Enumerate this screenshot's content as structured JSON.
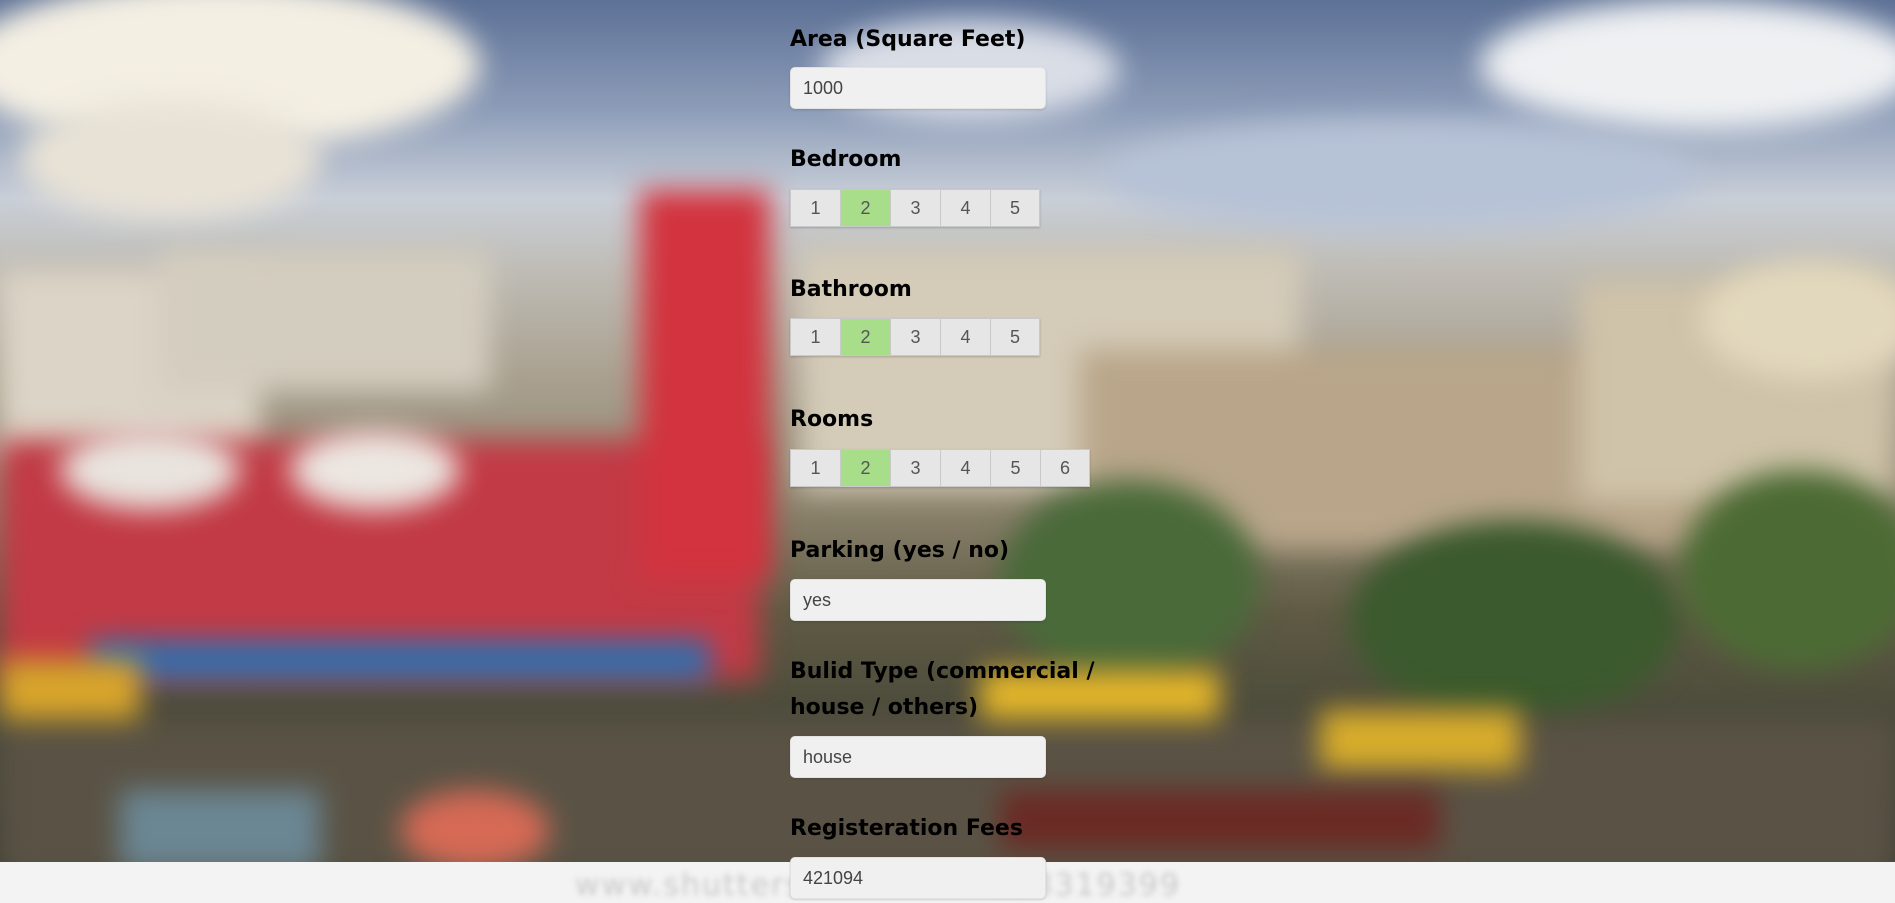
{
  "colors": {
    "selected": "#a8dd8a",
    "field_bg": "#f0f0f0",
    "option_bg": "#e6e6e6"
  },
  "watermark": "www.shutterstock.com · 438319399",
  "form": {
    "area": {
      "label": "Area (Square Feet)",
      "value": "1000"
    },
    "bedroom": {
      "label": "Bedroom",
      "options": [
        "1",
        "2",
        "3",
        "4",
        "5"
      ],
      "selected": "2"
    },
    "bathroom": {
      "label": "Bathroom",
      "options": [
        "1",
        "2",
        "3",
        "4",
        "5"
      ],
      "selected": "2"
    },
    "rooms": {
      "label": "Rooms",
      "options": [
        "1",
        "2",
        "3",
        "4",
        "5",
        "6"
      ],
      "selected": "2"
    },
    "parking": {
      "label": "Parking (yes / no)",
      "value": "yes"
    },
    "build_type": {
      "label_line1": "Bulid Type (commercial /",
      "label_line2": "house / others)",
      "value": "house"
    },
    "registration_fees": {
      "label": "Registeration Fees",
      "value": "421094"
    }
  }
}
